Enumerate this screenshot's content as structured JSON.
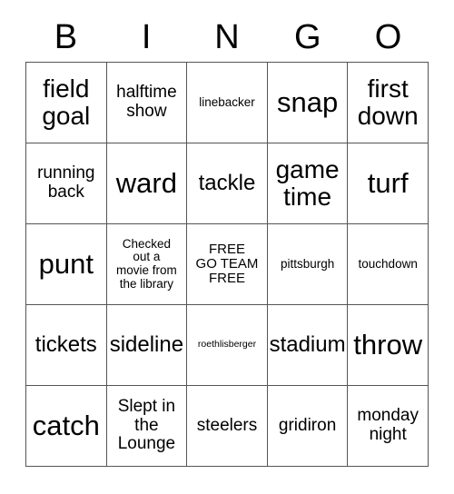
{
  "card": {
    "header": {
      "letters": [
        "B",
        "I",
        "N",
        "G",
        "O"
      ]
    },
    "rows": [
      [
        {
          "text": "field\ngoal",
          "size": "fs-xl"
        },
        {
          "text": "halftime\nshow",
          "size": "fs-m"
        },
        {
          "text": "linebacker",
          "size": "fs-xs"
        },
        {
          "text": "snap",
          "size": "fs-xxl"
        },
        {
          "text": "first\ndown",
          "size": "fs-xl"
        }
      ],
      [
        {
          "text": "running\nback",
          "size": "fs-m"
        },
        {
          "text": "ward",
          "size": "fs-xxl"
        },
        {
          "text": "tackle",
          "size": "fs-l"
        },
        {
          "text": "game\ntime",
          "size": "fs-xl"
        },
        {
          "text": "turf",
          "size": "fs-xxl"
        }
      ],
      [
        {
          "text": "punt",
          "size": "fs-xxl"
        },
        {
          "text": "Checked\nout a\nmovie from\nthe library",
          "size": "fs-xs"
        },
        {
          "text": "FREE\nGO TEAM\nFREE",
          "size": "fs-s"
        },
        {
          "text": "pittsburgh",
          "size": "fs-xs"
        },
        {
          "text": "touchdown",
          "size": "fs-xs"
        }
      ],
      [
        {
          "text": "tickets",
          "size": "fs-l"
        },
        {
          "text": "sideline",
          "size": "fs-l"
        },
        {
          "text": "roethlisberger",
          "size": "fs-xxs"
        },
        {
          "text": "stadium",
          "size": "fs-l"
        },
        {
          "text": "throw",
          "size": "fs-xxl"
        }
      ],
      [
        {
          "text": "catch",
          "size": "fs-xxl"
        },
        {
          "text": "Slept in\nthe\nLounge",
          "size": "fs-m"
        },
        {
          "text": "steelers",
          "size": "fs-m"
        },
        {
          "text": "gridiron",
          "size": "fs-m"
        },
        {
          "text": "monday\nnight",
          "size": "fs-m"
        }
      ]
    ],
    "colors": {
      "background": "#ffffff",
      "text": "#000000",
      "grid_line": "#555555"
    }
  }
}
